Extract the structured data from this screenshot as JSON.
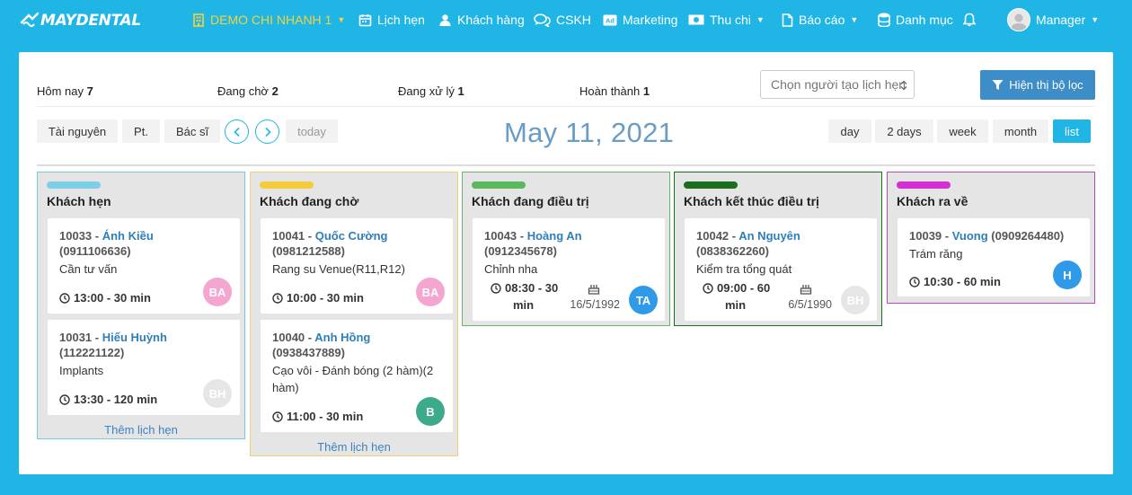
{
  "nav": {
    "logo": "MAYDENTAL",
    "branch": "DEMO CHI NHANH 1",
    "appointments": "Lịch hẹn",
    "customers": "Khách hàng",
    "cskh": "CSKH",
    "marketing": "Marketing",
    "finance": "Thu chi",
    "reports": "Báo cáo",
    "catalog": "Danh mục",
    "user": "Manager"
  },
  "stats": {
    "today_label": "Hôm nay",
    "today_count": "7",
    "waiting_label": "Đang chờ",
    "waiting_count": "2",
    "processing_label": "Đang xử lý",
    "processing_count": "1",
    "done_label": "Hoàn thành",
    "done_count": "1"
  },
  "creator_select": {
    "placeholder": "Chọn người tạo lịch hẹn"
  },
  "filter_button": "Hiện thị bộ lọc",
  "toolbar": {
    "resource": "Tài nguyên",
    "pt": "Pt.",
    "doctor": "Bác sĩ",
    "today": "today",
    "title": "May 11, 2021",
    "views": [
      "day",
      "2 days",
      "week",
      "month",
      "list"
    ],
    "active_view": "list"
  },
  "colors": {
    "accent": "#1fb6e6",
    "name_link": "#2e7eb8",
    "col_booked": "#7dcfe8",
    "col_waiting": "#f5cc3c",
    "col_treating": "#5cb85c",
    "col_finished": "#1b6e1b",
    "col_left": "#d32fd3"
  },
  "columns": [
    {
      "title": "Khách hẹn",
      "add_label": "Thêm lịch hẹn",
      "cards": [
        {
          "id": "10033",
          "name": "Ánh Kiều",
          "phone": "(0911106636)",
          "service": "Cần tư vấn",
          "time": "13:00 - 30 min",
          "badge": "BA",
          "badge_color": "#f4a6d0"
        },
        {
          "id": "10031",
          "name": "Hiếu Huỳnh",
          "phone": "(112221122)",
          "service": "Implants",
          "time": "13:30 - 120 min",
          "badge": "BH",
          "badge_color": "#e6e6e6"
        }
      ]
    },
    {
      "title": "Khách đang chờ",
      "add_label": "Thêm lịch hẹn",
      "cards": [
        {
          "id": "10041",
          "name": "Quốc Cường",
          "phone": "(0981212588)",
          "service": "Rang su Venue(R11,R12)",
          "time": "10:00 - 30 min",
          "badge": "BA",
          "badge_color": "#f4a6d0"
        },
        {
          "id": "10040",
          "name": "Anh Hồng",
          "phone": "(0938437889)",
          "service": "Cạo vôi - Đánh bóng (2 hàm)(2 hàm)",
          "time": "11:00 - 30 min",
          "badge": "B",
          "badge_color": "#3daa8c"
        }
      ]
    },
    {
      "title": "Khách đang điều trị",
      "cards": [
        {
          "id": "10043",
          "name": "Hoàng An",
          "phone": "(0912345678)",
          "service": "Chỉnh nha",
          "time_a": "08:30 - 30",
          "time_b": "min",
          "birthday": "16/5/1992",
          "badge": "TA",
          "badge_color": "#2f9be8"
        }
      ]
    },
    {
      "title": "Khách kết thúc điều trị",
      "cards": [
        {
          "id": "10042",
          "name": "An Nguyên",
          "phone": "(0838362260)",
          "service": "Kiểm tra tổng quát",
          "time_a": "09:00 - 60",
          "time_b": "min",
          "birthday": "6/5/1990",
          "badge": "BH",
          "badge_color": "#e6e6e6"
        }
      ]
    },
    {
      "title": "Khách ra về",
      "cards": [
        {
          "id": "10039",
          "name": "Vuong",
          "phone": "(0909264480)",
          "service": "Trám răng",
          "time": "10:30 - 60 min",
          "badge": "H",
          "badge_color": "#2f9be8"
        }
      ]
    }
  ]
}
